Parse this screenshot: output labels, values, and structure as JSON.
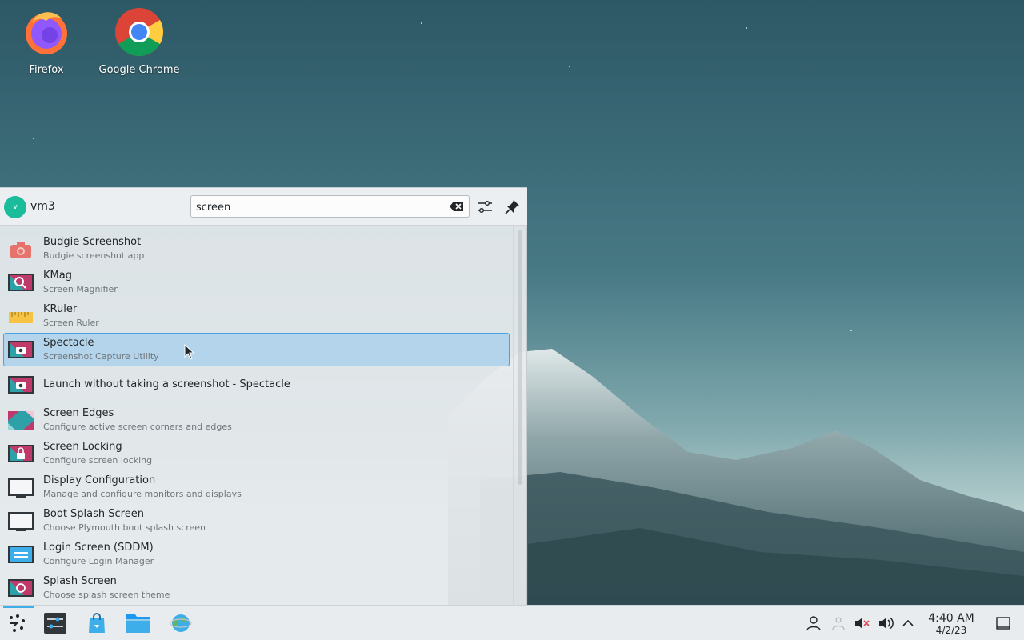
{
  "desktop": {
    "icons": [
      {
        "label": "Firefox"
      },
      {
        "label": "Google Chrome"
      }
    ]
  },
  "launcher": {
    "user": {
      "initial": "v",
      "name": "vm3"
    },
    "search": {
      "value": "screen"
    },
    "results": [
      {
        "title": "Budgie Screenshot",
        "subtitle": "Budgie screenshot app",
        "icon": "camera-icon"
      },
      {
        "title": "KMag",
        "subtitle": "Screen Magnifier",
        "icon": "magnifier-icon"
      },
      {
        "title": "KRuler",
        "subtitle": "Screen Ruler",
        "icon": "ruler-icon"
      },
      {
        "title": "Spectacle",
        "subtitle": "Screenshot Capture Utility",
        "icon": "spectacle-icon",
        "selected": true
      },
      {
        "title": "Launch without taking a screenshot - Spectacle",
        "subtitle": "",
        "icon": "spectacle-icon"
      },
      {
        "title": "Screen Edges",
        "subtitle": "Configure active screen corners and edges",
        "icon": "screen-edges-icon"
      },
      {
        "title": "Screen Locking",
        "subtitle": "Configure screen locking",
        "icon": "lock-screen-icon"
      },
      {
        "title": "Display Configuration",
        "subtitle": "Manage and configure monitors and displays",
        "icon": "display-icon"
      },
      {
        "title": "Boot Splash Screen",
        "subtitle": "Choose Plymouth boot splash screen",
        "icon": "display-icon"
      },
      {
        "title": "Login Screen (SDDM)",
        "subtitle": "Configure Login Manager",
        "icon": "login-screen-icon"
      },
      {
        "title": "Splash Screen",
        "subtitle": "Choose splash screen theme",
        "icon": "splash-screen-icon"
      }
    ]
  },
  "taskbar": {
    "clock": {
      "time": "4:40 AM",
      "date": "4/2/23"
    }
  },
  "colors": {
    "accent": "#3daee9",
    "selection": "#96c8eb",
    "panel": "#e9ecee"
  }
}
